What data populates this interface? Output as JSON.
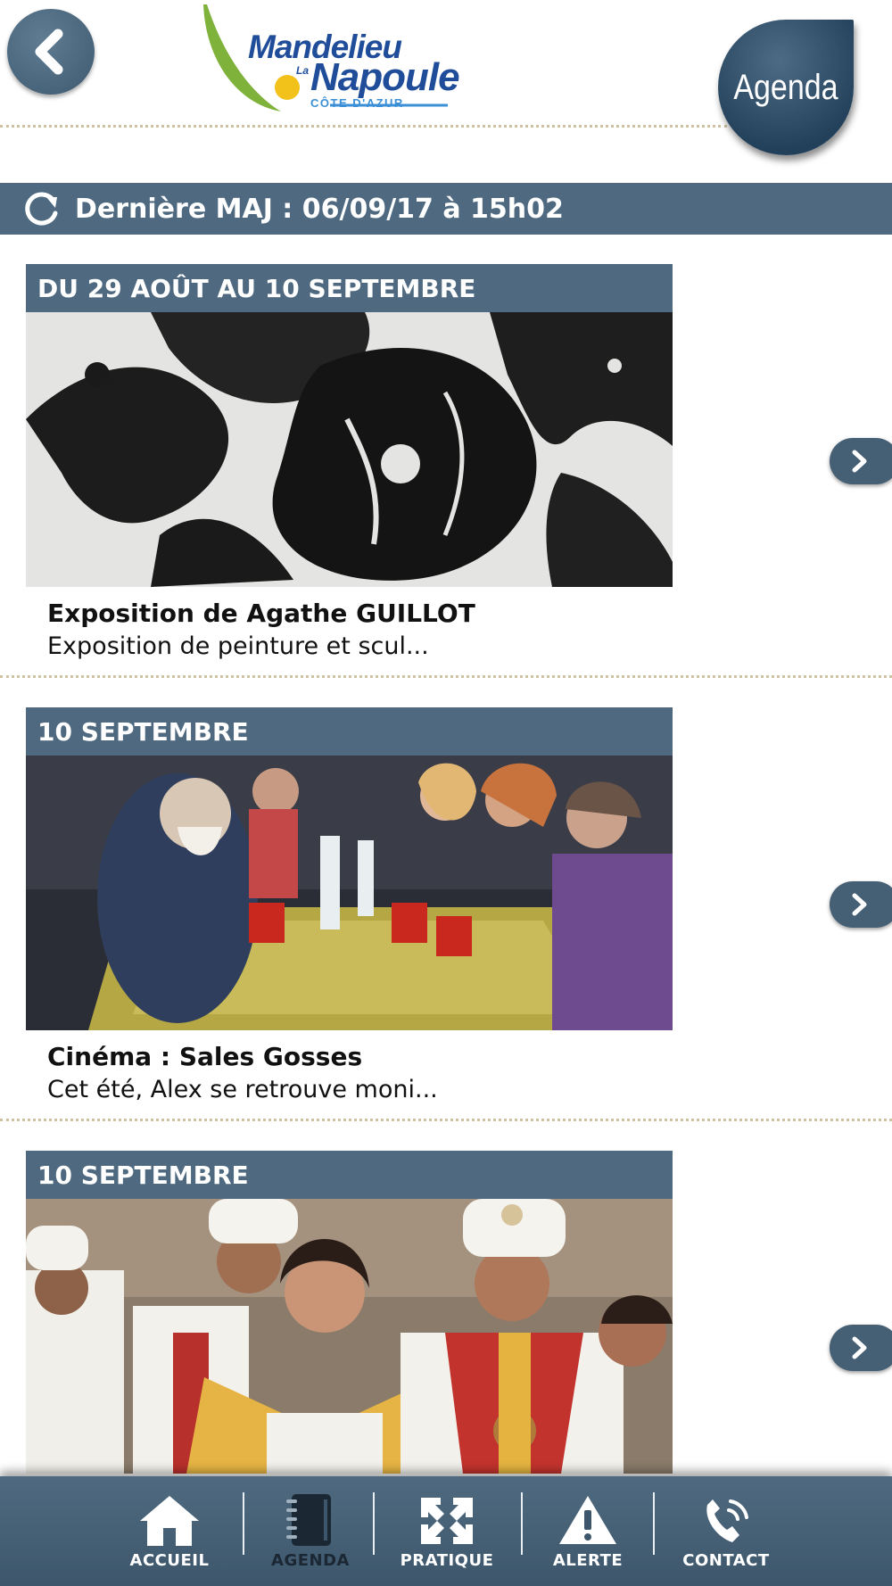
{
  "header": {
    "logo": {
      "line1": "Mandelieu",
      "line2_small": "La",
      "line2": "Napoule",
      "line3": "CÔTE D'AZUR"
    },
    "agenda_label": "Agenda"
  },
  "update_bar": {
    "text": "Dernière MAJ : 06/09/17 à 15h02"
  },
  "events": [
    {
      "date": "DU 29 AOÛT AU 10 SEPTEMBRE",
      "title": "Exposition de Agathe GUILLOT",
      "description": "Exposition de peinture et scul..."
    },
    {
      "date": "10 SEPTEMBRE",
      "title": "Cinéma : Sales Gosses",
      "description": "Cet été, Alex se retrouve moni..."
    },
    {
      "date": "10 SEPTEMBRE",
      "title": "",
      "description": ""
    }
  ],
  "tabbar": {
    "tabs": [
      {
        "label": "ACCUEIL",
        "icon": "home-icon",
        "active": false
      },
      {
        "label": "AGENDA",
        "icon": "agenda-icon",
        "active": true
      },
      {
        "label": "PRATIQUE",
        "icon": "pratique-icon",
        "active": false
      },
      {
        "label": "ALERTE",
        "icon": "alert-icon",
        "active": false
      },
      {
        "label": "CONTACT",
        "icon": "phone-icon",
        "active": false
      }
    ]
  },
  "colors": {
    "bar_blue": "#4f6a80",
    "logo_blue": "#1f4d9a",
    "logo_green": "#7fb23a",
    "logo_yellow": "#f2c21b",
    "separator": "#cfc2a0"
  }
}
